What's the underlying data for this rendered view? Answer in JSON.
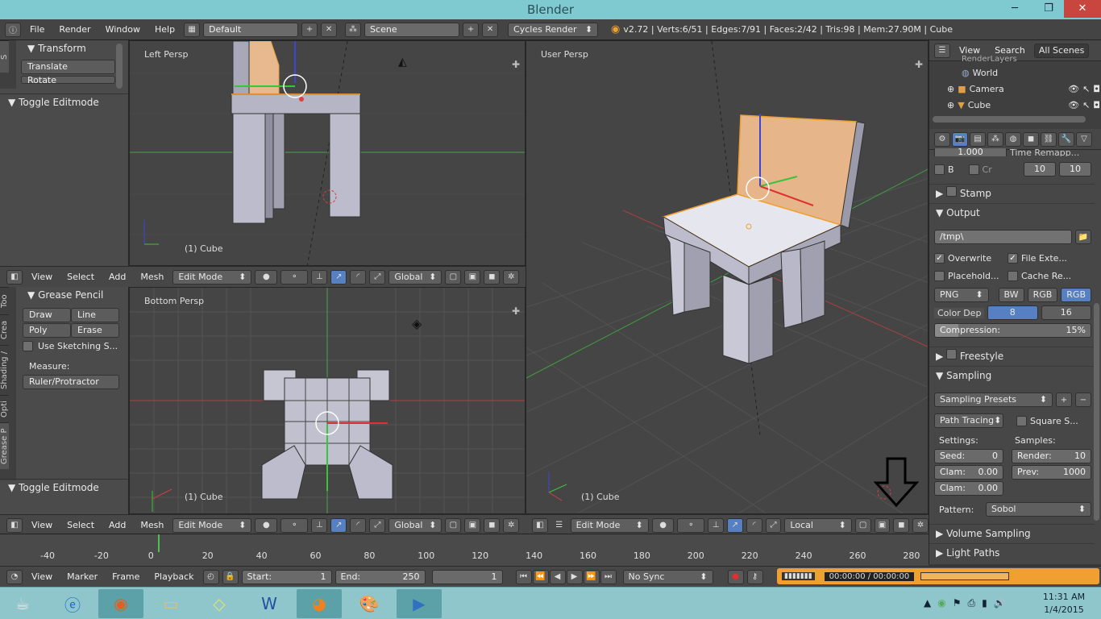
{
  "window": {
    "title": "Blender",
    "minimize": "─",
    "maximize": "❐",
    "close": "✕"
  },
  "info": {
    "menus": [
      "File",
      "Render",
      "Window",
      "Help"
    ],
    "layout": "Default",
    "scene": "Scene",
    "engine": "Cycles Render",
    "stats": "v2.72 | Verts:6/51 | Edges:7/91 | Faces:2/42 | Tris:98 | Mem:27.90M | Cube"
  },
  "shelf_top": {
    "tab": "S",
    "transform_title": "Transform",
    "buttons": [
      "Translate",
      "Rotate"
    ],
    "toggle": "Toggle Editmode"
  },
  "shelf_bottom": {
    "tabs": [
      "Too",
      "Crea",
      "Shading /",
      "Opti",
      "Grease P"
    ],
    "gp_title": "Grease Pencil",
    "draw": "Draw",
    "line": "Line",
    "poly": "Poly",
    "erase": "Erase",
    "sketch": "Use Sketching S...",
    "measure_label": "Measure:",
    "ruler": "Ruler/Protractor",
    "toggle": "Toggle Editmode"
  },
  "viewports": {
    "top_left": {
      "label": "Left Persp",
      "object": "(1) Cube"
    },
    "bottom_left": {
      "label": "Bottom Persp",
      "object": "(1) Cube"
    },
    "right": {
      "label": "User Persp",
      "object": "(1) Cube"
    }
  },
  "vp_header": {
    "menus": [
      "View",
      "Select",
      "Add",
      "Mesh"
    ],
    "mode": "Edit Mode",
    "orient_left": "Global",
    "orient_right": "Local"
  },
  "outliner": {
    "view": "View",
    "search": "Search",
    "scope": "All Scenes",
    "items": [
      "RenderLayers",
      "World",
      "Camera",
      "Cube"
    ]
  },
  "properties": {
    "aspect_val": "1.000",
    "time_remap": "Time Remapp...",
    "border": "B",
    "crop": "Cr",
    "remap_old": "10",
    "remap_new": "10",
    "stamp": "Stamp",
    "output": "Output",
    "path": "/tmp\\",
    "overwrite": "Overwrite",
    "file_ext": "File Exte...",
    "placeholders": "Placehold...",
    "cache": "Cache Re...",
    "format": "PNG",
    "bw": "BW",
    "rgb": "RGB",
    "rgba": "RGB",
    "color_depth": "Color Dep",
    "depth8": "8",
    "depth16": "16",
    "compression_label": "Compression:",
    "compression": "15%",
    "freestyle": "Freestyle",
    "sampling": "Sampling",
    "presets": "Sampling Presets",
    "integrator": "Path Tracing",
    "square": "Square S...",
    "settings": "Settings:",
    "samples": "Samples:",
    "seed": "Seed:",
    "seed_val": "0",
    "render": "Render:",
    "render_val": "10",
    "clam1": "Clam:",
    "clam1_val": "0.00",
    "prev": "Prev:",
    "prev_val": "1000",
    "clam2": "Clam:",
    "clam2_val": "0.00",
    "pattern": "Pattern:",
    "pattern_val": "Sobol",
    "volume": "Volume Sampling",
    "light_paths": "Light Paths"
  },
  "timeline": {
    "ticks": [
      "-40",
      "-20",
      "0",
      "20",
      "40",
      "60",
      "80",
      "100",
      "120",
      "140",
      "160",
      "180",
      "200",
      "220",
      "240",
      "260",
      "280"
    ],
    "menus": [
      "View",
      "Marker",
      "Frame",
      "Playback"
    ],
    "start_label": "Start:",
    "start": "1",
    "end_label": "End:",
    "end": "250",
    "current": "1",
    "sync": "No Sync",
    "time": "00:00:00 / 00:00:00"
  },
  "taskbar": {
    "time": "11:31 AM",
    "date": "1/4/2015"
  }
}
